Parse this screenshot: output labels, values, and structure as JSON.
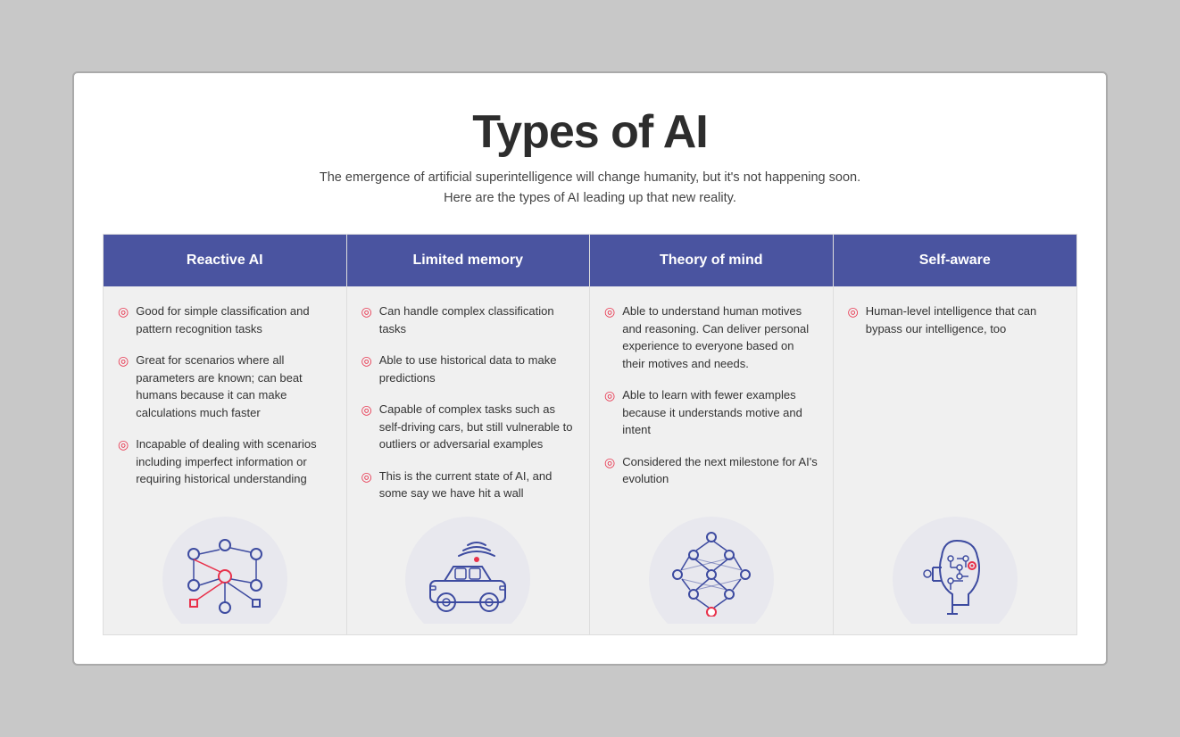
{
  "page": {
    "title": "Types of AI",
    "subtitle_line1": "The emergence of artificial superintelligence will change humanity, but it's not happening soon.",
    "subtitle_line2": "Here are the types of AI leading up that new reality."
  },
  "columns": [
    {
      "id": "reactive-ai",
      "header": "Reactive AI",
      "bullets": [
        "Good for simple classification and pattern recognition tasks",
        "Great for scenarios where all parameters are known; can beat humans because it can make calculations much faster",
        "Incapable of dealing with scenarios including imperfect information or requiring historical understanding"
      ]
    },
    {
      "id": "limited-memory",
      "header": "Limited memory",
      "bullets": [
        "Can handle complex classification tasks",
        "Able to use historical data to make predictions",
        "Capable of complex tasks such as self-driving cars, but still vulnerable to outliers or adversarial examples",
        "This is the current state of AI, and some say we have hit a wall"
      ]
    },
    {
      "id": "theory-of-mind",
      "header": "Theory of mind",
      "bullets": [
        "Able to understand human motives and reasoning. Can deliver personal experience to everyone based on their motives and needs.",
        "Able to learn with fewer examples because it understands motive and intent",
        "Considered the next milestone for AI's evolution"
      ]
    },
    {
      "id": "self-aware",
      "header": "Self-aware",
      "bullets": [
        "Human-level intelligence that can bypass our intelligence, too"
      ]
    }
  ]
}
